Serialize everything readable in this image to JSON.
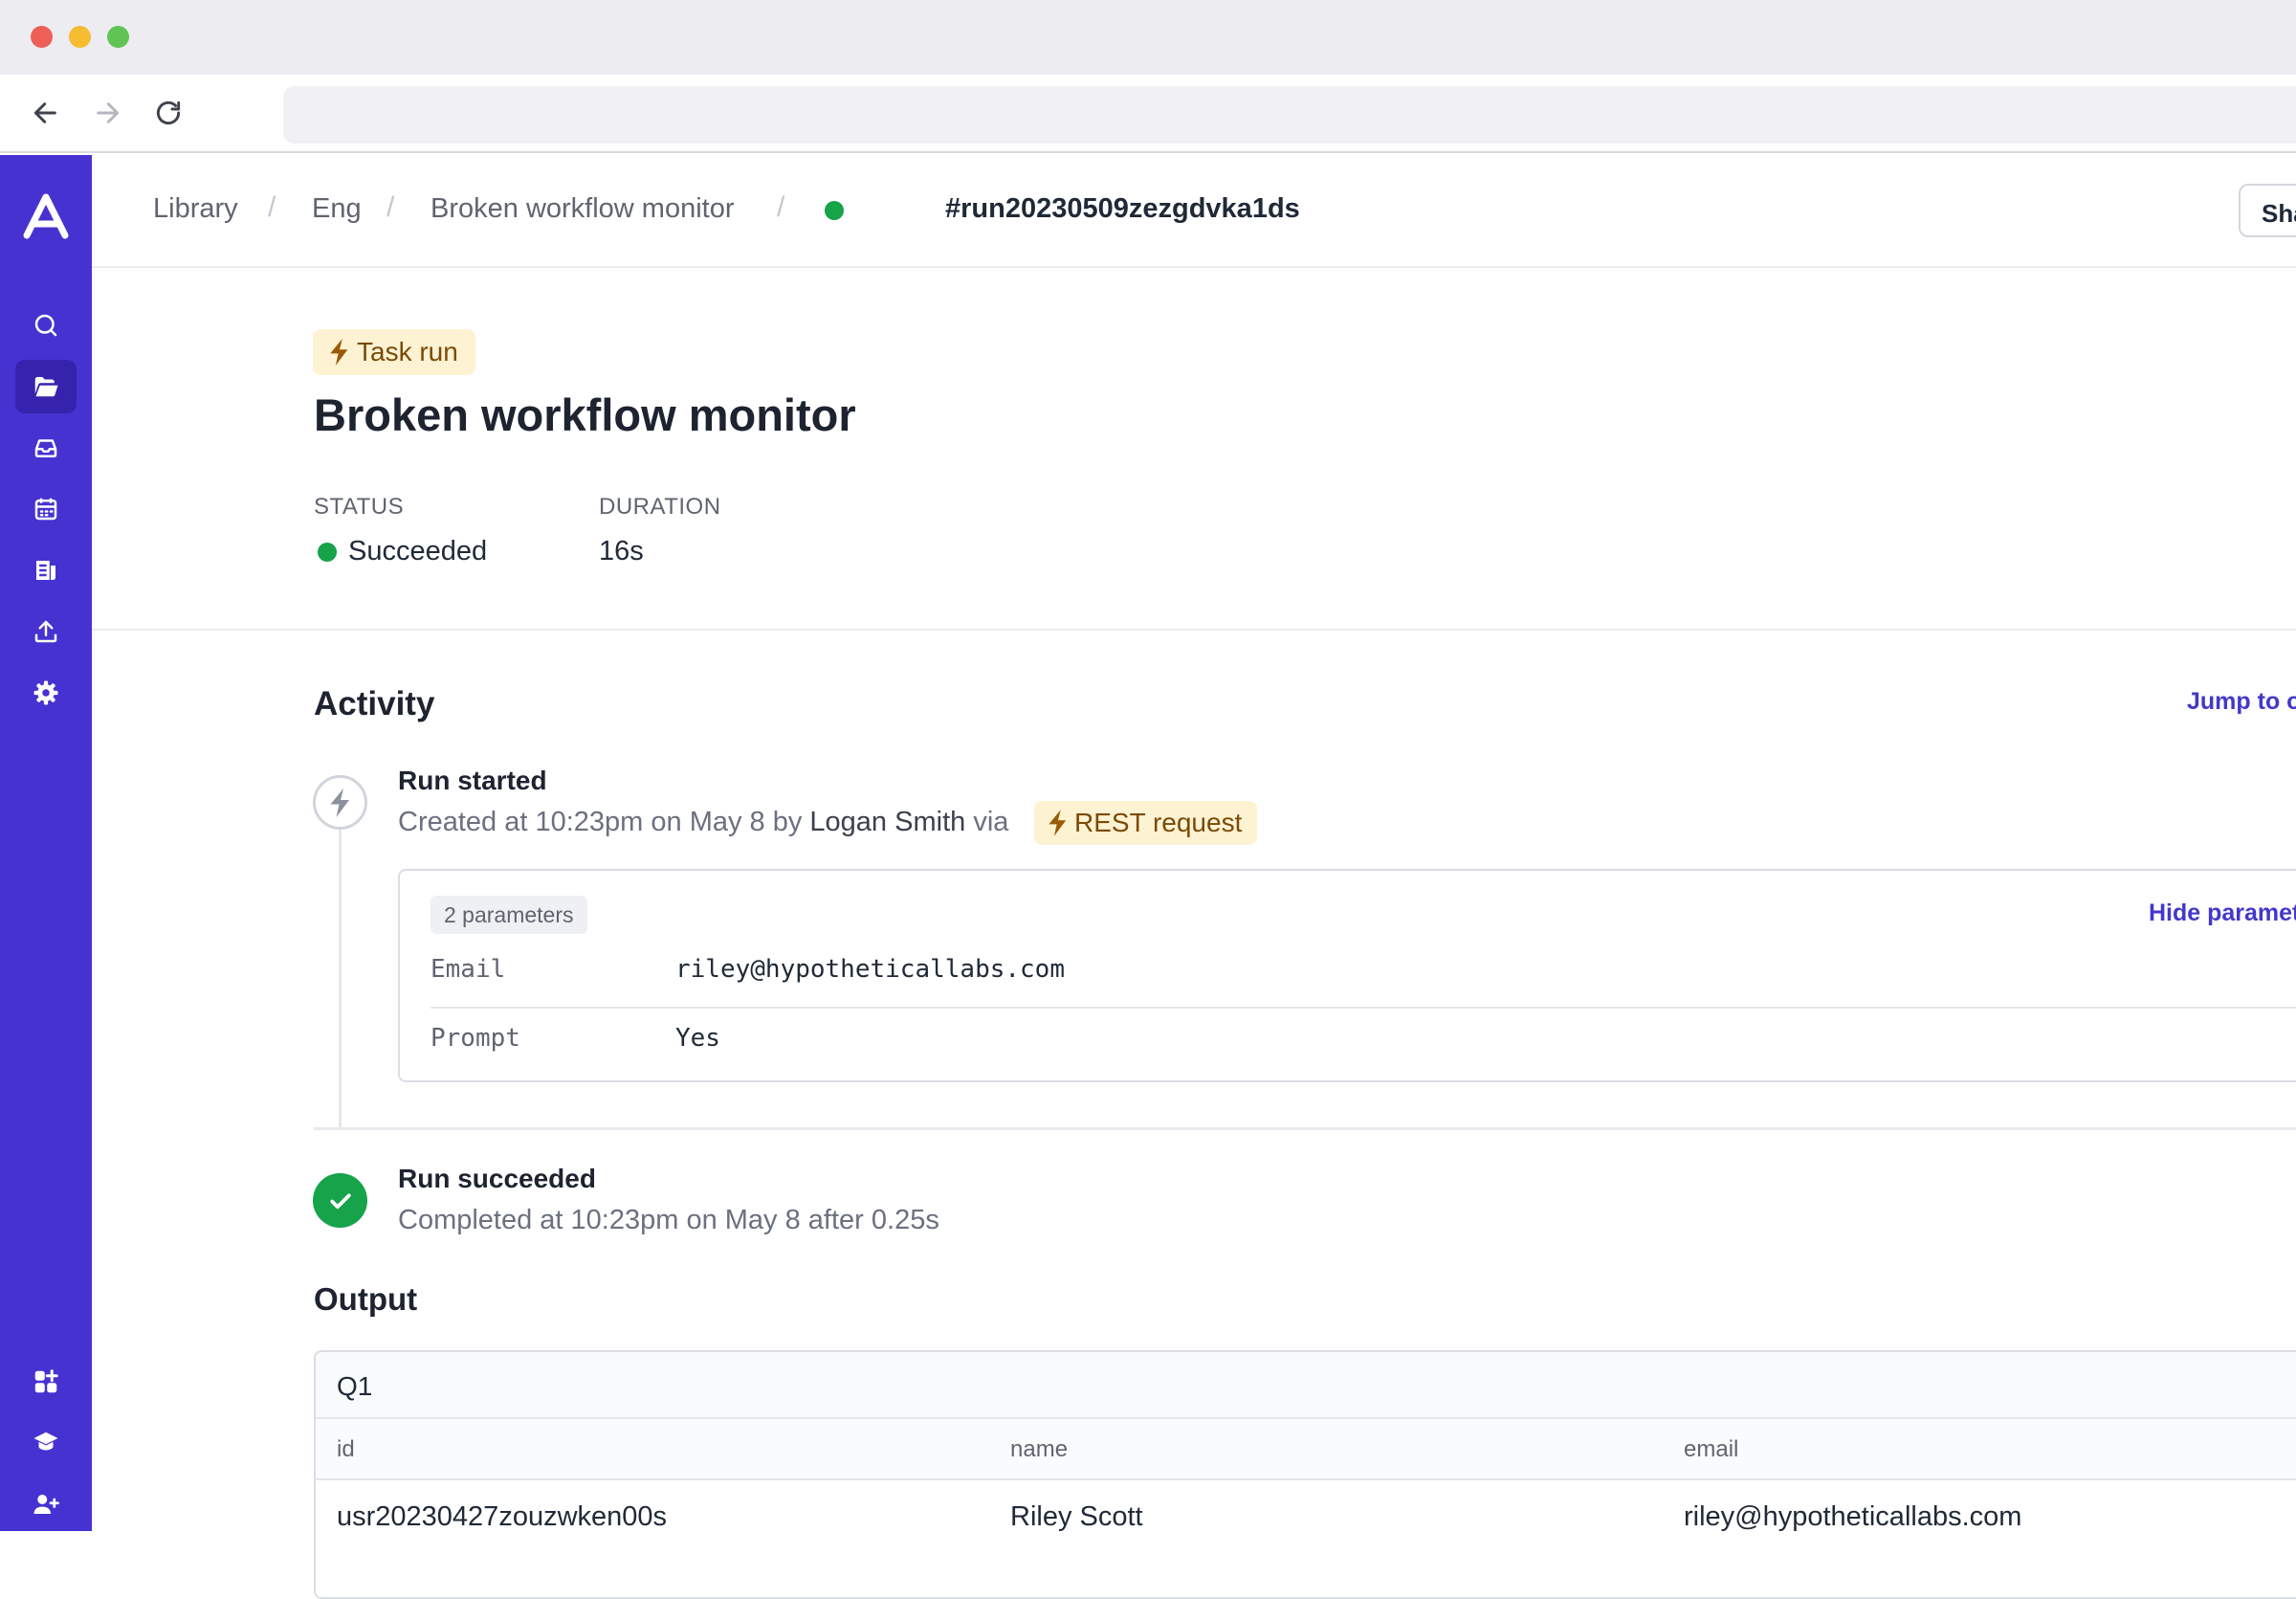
{
  "breadcrumb": {
    "items": [
      "Library",
      "Eng",
      "Broken workflow monitor"
    ],
    "separator": "/",
    "current_run": "#run20230509zezgdvka1ds"
  },
  "header": {
    "share_label": "Sha"
  },
  "run": {
    "type_badge": "Task run",
    "title": "Broken workflow monitor",
    "status_label": "STATUS",
    "status_value": "Succeeded",
    "duration_label": "DURATION",
    "duration_value": "16s"
  },
  "activity": {
    "title": "Activity",
    "jump_link": "Jump to o",
    "started": {
      "title": "Run started",
      "sub_prefix": "Created at 10:23pm on May 8 by",
      "user": "Logan Smith",
      "via": "via",
      "badge": "REST request"
    },
    "params": {
      "count": "2 parameters",
      "hide_link": "Hide paramet",
      "rows": [
        {
          "key": "Email",
          "value": "riley@hypotheticallabs.com"
        },
        {
          "key": "Prompt",
          "value": "Yes"
        }
      ]
    },
    "succeeded": {
      "title": "Run succeeded",
      "sub": "Completed at 10:23pm on May 8 after 0.25s"
    }
  },
  "output": {
    "title": "Output",
    "table_name": "Q1",
    "columns": [
      "id",
      "name",
      "email"
    ],
    "rows": [
      [
        "usr20230427zouzwken00s",
        "Riley Scott",
        "riley@hypotheticallabs.com"
      ]
    ]
  },
  "colors": {
    "sidebar": "#4632d1",
    "accent_link": "#4338ca",
    "success": "#16a34a",
    "badge_bg": "#fdf3d3"
  }
}
